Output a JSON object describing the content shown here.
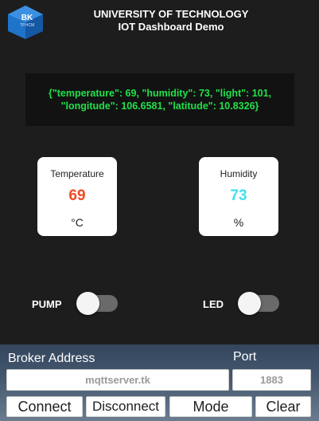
{
  "header": {
    "logo": {
      "text": "BK",
      "subtext": "TP.HCM"
    },
    "title": "UNIVERSITY OF TECHNOLOGY",
    "subtitle": "IOT Dashboard Demo"
  },
  "payload": {
    "line1": "{\"temperature\": 69, \"humidity\": 73, \"light\": 101,",
    "line2": "\"longitude\": 106.6581, \"latitude\": 10.8326}"
  },
  "cards": {
    "temperature": {
      "label": "Temperature",
      "value": "69",
      "unit": "°C",
      "value_color": "#f04a22"
    },
    "humidity": {
      "label": "Humidity",
      "value": "73",
      "unit": "%",
      "value_color": "#3fe0ef"
    }
  },
  "switches": {
    "pump": {
      "label": "PUMP",
      "state": "off"
    },
    "led": {
      "label": "LED",
      "state": "off"
    }
  },
  "connection": {
    "broker_label": "Broker Address",
    "broker_value": "mqttserver.tk",
    "port_label": "Port",
    "port_value": "1883"
  },
  "buttons": {
    "connect": "Connect",
    "disconnect": "Disconnect",
    "mode": "Mode",
    "clear": "Clear"
  },
  "colors": {
    "background": "#1d1d1d",
    "json_text": "#22e04a"
  }
}
